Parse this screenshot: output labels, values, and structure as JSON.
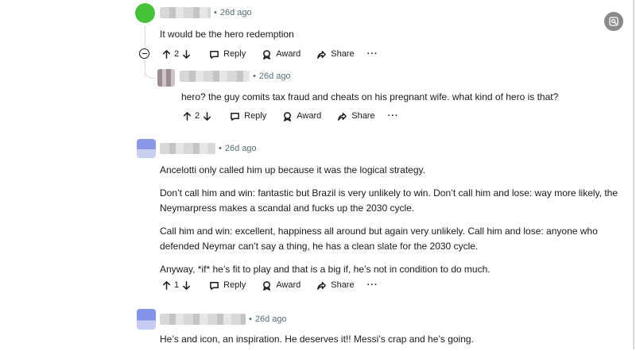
{
  "comments": [
    {
      "time": "26d ago",
      "body": [
        "It would be the hero redemption"
      ],
      "votes": "2"
    },
    {
      "time": "26d ago",
      "body": [
        "hero? the guy comits tax fraud and cheats on his pregnant wife. what kind of hero is that?"
      ],
      "votes": "2"
    },
    {
      "time": "26d ago",
      "body": [
        "Ancelotti only called him up because it was the logical strategy.",
        "Don’t call him and win: fantastic but Brazil is very unlikely to win. Don’t call him and lose: way more likely, the",
        "Neymarpress makes a scandal and fucks up the 2030 cycle.",
        "Call him and win: excellent, happiness all around but again very unlikely. Call him and lose: anyone who",
        "defended Neymar can’t say a thing, he has a clean slate for the 2030 cycle.",
        "Anyway, *if* he’s fit to play and that is a big if, he’s not in condition to do much."
      ],
      "votes": "1"
    },
    {
      "time": "26d ago",
      "body": [
        "He’s and icon, an inspiration. He deserves it!! Messi’s crap and he’s going."
      ]
    }
  ],
  "actions": {
    "reply": "Reply",
    "award": "Award",
    "share": "Share",
    "more": "···",
    "collapse": "⊖"
  },
  "colors": {
    "avatar1": "#46c23a",
    "avatar3": "#7f8fe0",
    "avatar4": "#8493e8",
    "meta": "#576f76"
  },
  "icons": [
    "upvote-icon",
    "downvote-icon",
    "reply-icon",
    "award-icon",
    "share-icon",
    "search-lens-icon",
    "collapse-icon"
  ]
}
